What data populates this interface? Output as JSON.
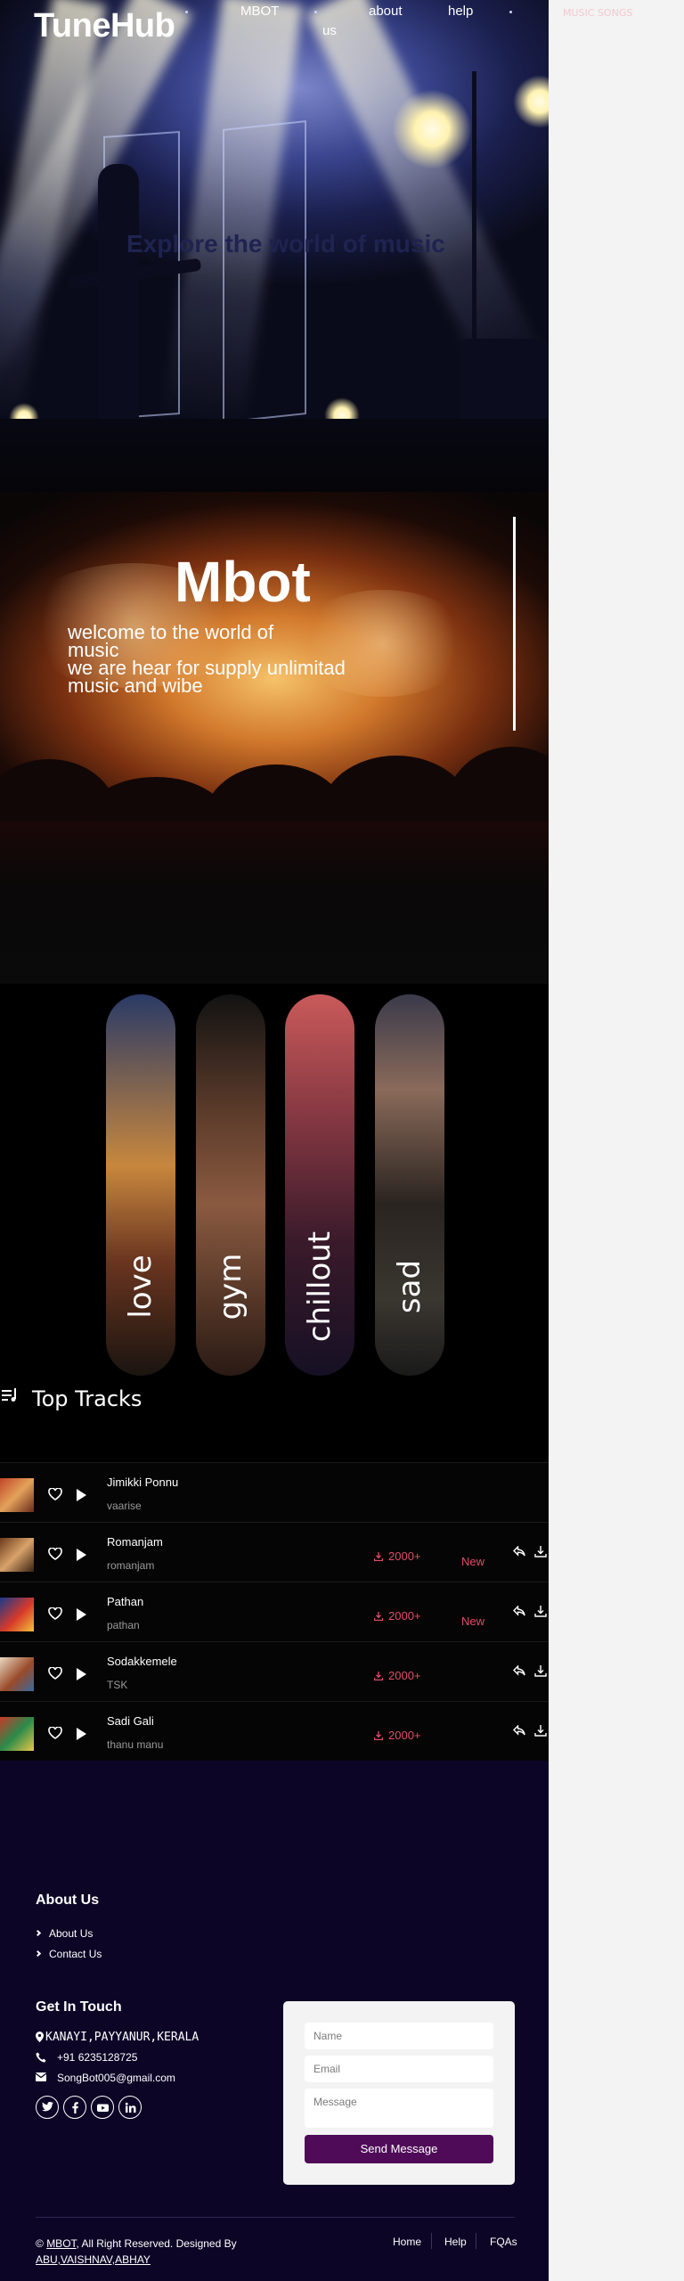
{
  "header": {
    "brand": "TuneHub",
    "nav": [
      "MBOT",
      "about",
      "help"
    ],
    "nav_second_line": "us",
    "tagline": "Explore the world of music",
    "side_link": "MUSIC SONGS"
  },
  "hero2": {
    "title": "Mbot",
    "lines": [
      "welcome to the world of",
      "music",
      "we are hear for supply unlimitad",
      "music and wibe"
    ]
  },
  "moods": [
    {
      "label": "love"
    },
    {
      "label": "gym"
    },
    {
      "label": "chillout"
    },
    {
      "label": "sad"
    }
  ],
  "tracks_section": {
    "title": "Top Tracks",
    "tracks": [
      {
        "title": "Jimikki Ponnu",
        "subtitle": "vaarise",
        "downloads": "",
        "badge": ""
      },
      {
        "title": "Romanjam",
        "subtitle": "romanjam",
        "downloads": "2000+",
        "badge": "New"
      },
      {
        "title": "Pathan",
        "subtitle": "pathan",
        "downloads": "2000+",
        "badge": "New"
      },
      {
        "title": "Sodakkemele",
        "subtitle": "TSK",
        "downloads": "2000+",
        "badge": ""
      },
      {
        "title": "Sadi Gali",
        "subtitle": "thanu manu",
        "downloads": "2000+",
        "badge": ""
      }
    ]
  },
  "footer": {
    "about_title": "About Us",
    "links": [
      "About Us",
      "Contact Us"
    ],
    "touch_title": "Get In Touch",
    "address": "KANAYI,PAYYANUR,KERALA",
    "phone": "+91 6235128725",
    "email": "SongBot005@gmail.com",
    "social_icons": [
      "twitter-icon",
      "facebook-icon",
      "youtube-icon",
      "linkedin-icon"
    ],
    "form": {
      "name_placeholder": "Name",
      "email_placeholder": "Email",
      "message_placeholder": "Message",
      "send_label": "Send Message"
    },
    "copyright_prefix": "©",
    "copyright_brand": "MBOT",
    "copyright_text": ", All Right Reserved. Designed By",
    "designers": "ABU,VAISHNAV,ABHAY",
    "bottom_links": [
      "Home",
      "Help",
      "FQAs"
    ]
  },
  "colors": {
    "accent_pink": "#e24d6a",
    "footer_bg": "#0c0526",
    "send_button": "#4f0a58"
  }
}
